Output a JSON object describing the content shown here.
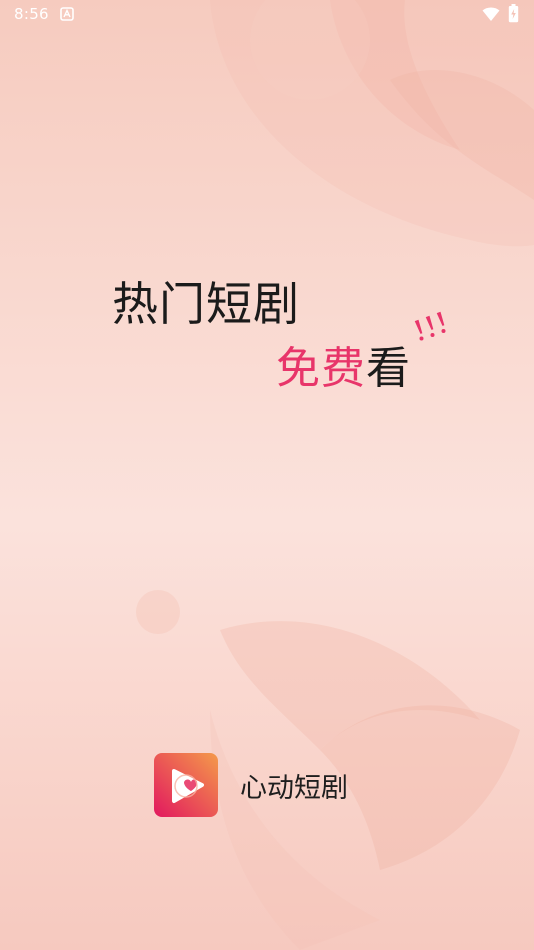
{
  "status_bar": {
    "time": "8:56",
    "icons": [
      "notification-a-icon",
      "wifi-icon",
      "battery-icon"
    ]
  },
  "splash": {
    "headline_line1": "热门短剧",
    "headline_line2_highlight": "免费",
    "headline_line2_rest": "看",
    "highlight_color": "#e8356a",
    "text_color": "#1b1b1b"
  },
  "brand": {
    "app_name": "心动短剧",
    "logo_icon": "play-heart-logo-icon",
    "logo_gradient": [
      "#e2185f",
      "#f49a4a"
    ]
  }
}
